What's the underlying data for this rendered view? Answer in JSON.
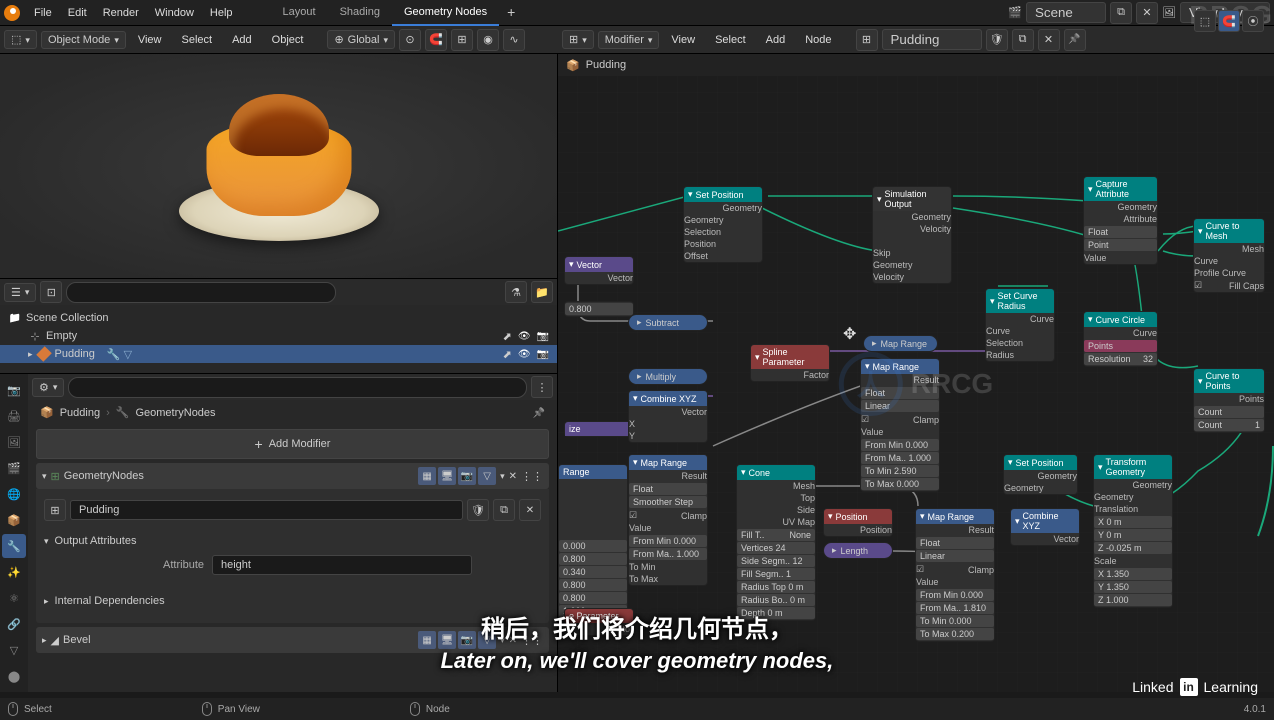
{
  "app": {
    "menus": [
      "File",
      "Edit",
      "Render",
      "Window",
      "Help"
    ],
    "workspaces": [
      "Layout",
      "Shading",
      "Geometry Nodes"
    ],
    "active_workspace": "Geometry Nodes",
    "scene": "Scene",
    "view_layer": "View Layer"
  },
  "viewport_toolbar": {
    "mode": "Object Mode",
    "menus": [
      "View",
      "Select",
      "Add",
      "Object"
    ],
    "orientation": "Global"
  },
  "node_toolbar": {
    "mode": "Modifier",
    "menus": [
      "View",
      "Select",
      "Add",
      "Node"
    ],
    "node_tree": "Pudding"
  },
  "node_path": {
    "object": "Pudding"
  },
  "outliner": {
    "collection": "Scene Collection",
    "items": [
      {
        "name": "Empty",
        "type": "empty"
      },
      {
        "name": "Pudding",
        "type": "mesh",
        "active": true
      }
    ]
  },
  "properties": {
    "breadcrumb_obj": "Pudding",
    "breadcrumb_mod": "GeometryNodes",
    "add_modifier": "Add Modifier",
    "modifiers": [
      {
        "name": "GeometryNodes",
        "node_group": "Pudding",
        "output_attrs_label": "Output Attributes",
        "attribute_label": "Attribute",
        "attribute_value": "height",
        "internal_deps_label": "Internal Dependencies"
      },
      {
        "name": "Bevel"
      }
    ]
  },
  "nodes": {
    "set_position": {
      "title": "Set Position",
      "outputs": [
        "Geometry"
      ],
      "inputs": [
        "Geometry",
        "Selection",
        "Position",
        "Offset"
      ]
    },
    "simulation_output": {
      "title": "Simulation Output",
      "outputs": [
        "Geometry",
        "Velocity"
      ],
      "inputs": [
        "Skip",
        "Geometry",
        "Velocity"
      ]
    },
    "capture_attribute": {
      "title": "Capture Attribute",
      "outputs": [
        "Geometry",
        "Attribute"
      ],
      "fields": [
        "Float",
        "Point"
      ],
      "inputs": [
        "Value"
      ]
    },
    "curve_to_mesh": {
      "title": "Curve to Mesh",
      "outputs": [
        "Mesh"
      ],
      "inputs": [
        "Curve",
        "Profile Curve",
        "Fill Caps"
      ]
    },
    "set_curve_radius": {
      "title": "Set Curve Radius",
      "outputs": [
        "Curve"
      ],
      "inputs": [
        "Curve",
        "Selection",
        "Radius"
      ]
    },
    "curve_circle": {
      "title": "Curve Circle",
      "outputs": [
        "Curve"
      ],
      "mode": "Points",
      "resolution_label": "Resolution",
      "resolution": "32"
    },
    "curve_to_points": {
      "title": "Curve to Points",
      "outputs": [
        "Points"
      ],
      "mode": "Count",
      "count_label": "Count",
      "count": "1"
    },
    "subtract": {
      "title": "Subtract"
    },
    "multiply": {
      "title": "Multiply"
    },
    "vector": {
      "title": "Vector"
    },
    "value_0800": {
      "value": "0.800"
    },
    "combine_xyz": {
      "title": "Combine XYZ",
      "output": "Vector",
      "inputs": [
        "X",
        "Y"
      ]
    },
    "combine_xyz2": {
      "title": "Combine XYZ",
      "output": "Vector"
    },
    "spline_parameter": {
      "title": "Spline Parameter",
      "output": "Factor"
    },
    "position": {
      "title": "Position",
      "output": "Position"
    },
    "length": {
      "title": "Length"
    },
    "map_range_collapsed": {
      "title": "Map Range"
    },
    "map_range1": {
      "title": "Map Range",
      "output": "Result",
      "type": "Float",
      "interp": "Linear",
      "clamp": "Clamp",
      "value_label": "Value",
      "from_min": "From Min   0.000",
      "from_max": "From Ma..  1.000",
      "to_min": "To Min   2.590",
      "to_max": "To Max   0.000"
    },
    "map_range2": {
      "title": "Map Range",
      "output": "Result",
      "type": "Float",
      "step": "Smoother Step",
      "clamp": "Clamp",
      "value_label": "Value",
      "from_min": "From Min   0.000",
      "from_max": "From Ma..  1.000",
      "to_min": "To Min",
      "to_max": "To Max"
    },
    "map_range3": {
      "title": "Map Range",
      "output": "Result",
      "type": "Float",
      "interp": "Linear",
      "clamp": "Clamp",
      "value_label": "Value",
      "from_min": "From Min   0.000",
      "from_max": "From Ma..  1.810",
      "to_min": "To Min   0.000",
      "to_max": "To Max   0.200"
    },
    "cone": {
      "title": "Cone",
      "outputs": [
        "Mesh",
        "Top",
        "Side",
        "UV Map"
      ],
      "fill_label": "Fill T..",
      "fill": "None",
      "vertices": "Vertices       24",
      "side_segm": "Side Segm..  12",
      "fill_segm": "Fill Segm..   1",
      "radius_top": "Radius Top  0 m",
      "radius_bot": "Radius Bo.. 0 m",
      "depth": "Depth        0 m"
    },
    "set_position2": {
      "title": "Set Position",
      "outputs": [
        "Geometry"
      ],
      "inputs": [
        "Geometry"
      ]
    },
    "transform_geometry": {
      "title": "Transform Geometry",
      "outputs": [
        "Geometry"
      ],
      "inputs": [
        "Geometry"
      ],
      "translation_label": "Translation",
      "tx": "X           0 m",
      "ty": "Y           0 m",
      "tz": "Z      -0.025 m",
      "scale_label": "Scale",
      "sx": "X        1.350",
      "sy": "Y        1.350",
      "sz": "Z        1.000"
    },
    "range_partial": {
      "title": "Range",
      "rows": [
        "0.000",
        "0.800",
        "0.340",
        "0.800",
        "0.800",
        "1.000"
      ]
    },
    "ize": {
      "title": "ize"
    },
    "parameter": {
      "title": "e Parameter",
      "output": "Factor"
    }
  },
  "subtitles": {
    "cn": "稍后，我们将介绍几何节点，",
    "en": "Later on, we'll cover geometry nodes,"
  },
  "footer": {
    "select": "Select",
    "pan": "Pan View",
    "node": "Node",
    "version": "4.0.1"
  },
  "watermarks": {
    "rrcg": "RRCG",
    "linkedin": "LinkedIn Learning"
  }
}
